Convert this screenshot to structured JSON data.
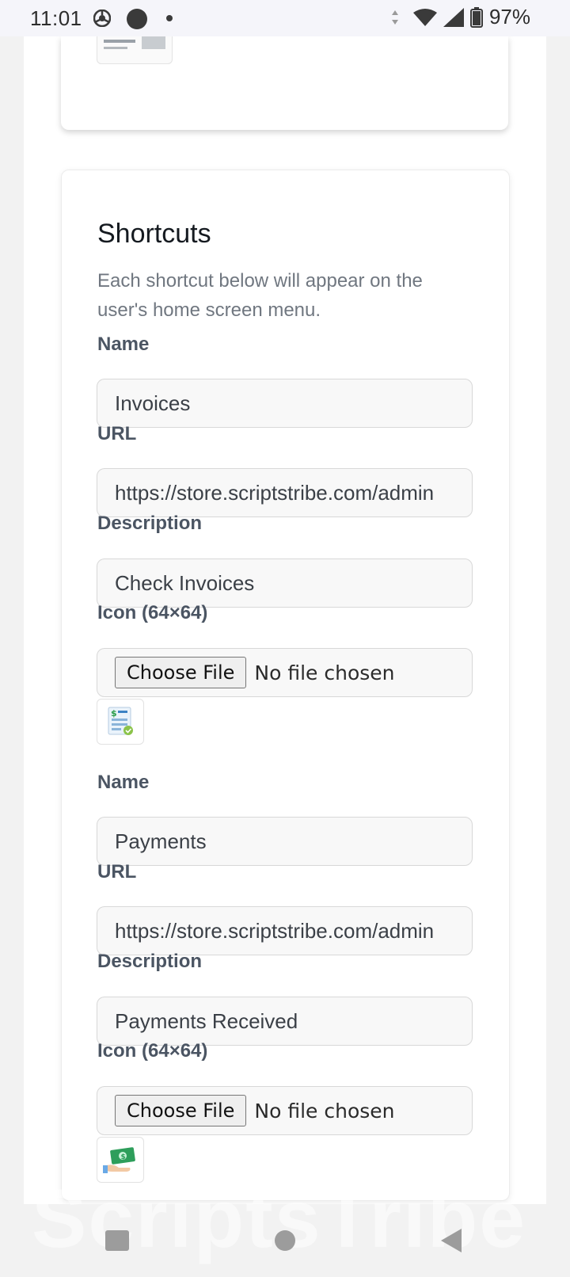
{
  "status_bar": {
    "time": "11:01",
    "battery": "97%"
  },
  "shortcuts": {
    "title": "Shortcuts",
    "description": "Each shortcut below will appear on the user's home screen menu.",
    "items": [
      {
        "name_label": "Name",
        "name_value": "Invoices",
        "url_label": "URL",
        "url_value": "https://store.scriptstribe.com/admin",
        "description_label": "Description",
        "description_value": "Check Invoices",
        "icon_label": "Icon (64×64)",
        "choose_file": "Choose File",
        "no_file": "No file chosen",
        "icon_name": "invoice-icon"
      },
      {
        "name_label": "Name",
        "name_value": "Payments",
        "url_label": "URL",
        "url_value": "https://store.scriptstribe.com/admin",
        "description_label": "Description",
        "description_value": "Payments Received",
        "icon_label": "Icon (64×64)",
        "choose_file": "Choose File",
        "no_file": "No file chosen",
        "icon_name": "payment-icon"
      }
    ]
  },
  "watermark": "ScriptsTribe",
  "colors": {
    "field_bg": "#f8f8f8",
    "label": "#4b5563",
    "muted": "#707780"
  }
}
